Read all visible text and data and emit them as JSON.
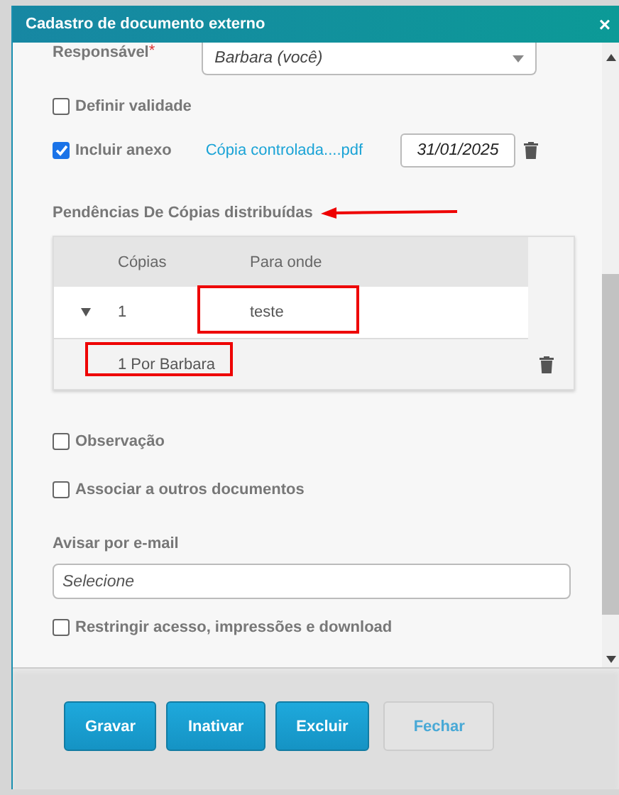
{
  "dialog": {
    "title": "Cadastro de documento externo",
    "close_label": "×"
  },
  "responsible": {
    "label": "Responsável",
    "required_mark": "*",
    "value": "Barbara (você)"
  },
  "validity": {
    "label": "Definir validade",
    "checked": false
  },
  "attachment": {
    "label": "Incluir anexo",
    "checked": true,
    "file": "Cópia controlada....pdf",
    "date": "31/01/2025"
  },
  "copies_section": {
    "title": "Pendências De Cópias distribuídas",
    "table": {
      "columns": [
        "Cópias",
        "Para onde"
      ],
      "rows": [
        {
          "expanded": true,
          "copies": "1",
          "destination": "teste",
          "detail": "1 Por Barbara"
        }
      ]
    }
  },
  "options": [
    {
      "label": "Observação",
      "checked": false
    },
    {
      "label": "Associar a outros documentos",
      "checked": false
    }
  ],
  "email": {
    "label": "Avisar por e-mail",
    "placeholder": "Selecione"
  },
  "restrict": {
    "label": "Restringir acesso, impressões e download",
    "checked": false
  },
  "buttons": [
    {
      "label": "Gravar",
      "disabled": false
    },
    {
      "label": "Inativar",
      "disabled": false
    },
    {
      "label": "Excluir",
      "disabled": false
    },
    {
      "label": "Fechar",
      "disabled": true
    }
  ]
}
